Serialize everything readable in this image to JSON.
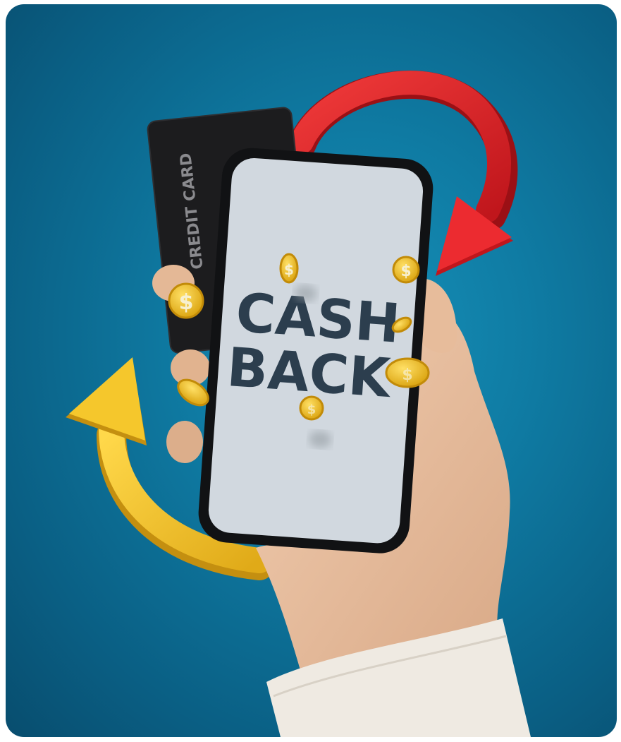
{
  "scene": {
    "card_label": "CREDIT CARD",
    "screen_line1": "CASH",
    "screen_line2": "BACK",
    "coin_symbol": "$"
  },
  "colors": {
    "background": "#0f7ba3",
    "screen": "#d1d8df",
    "screen_text": "#2c3e4e",
    "card": "#1c1c1e",
    "arrow_red": "#e0242a",
    "arrow_yellow": "#f2c52b",
    "coin": "#f0c020",
    "skin": "#e9c2a2",
    "sleeve": "#efeae2"
  }
}
